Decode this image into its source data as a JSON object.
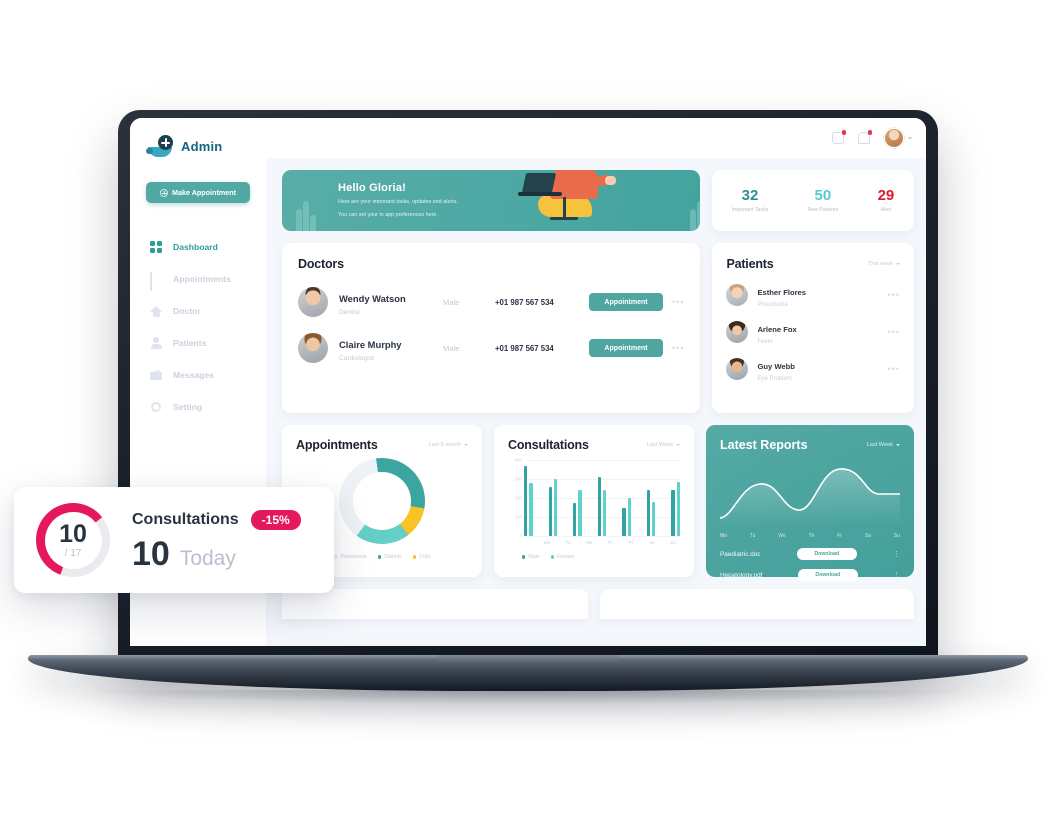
{
  "brand": {
    "name": "Admin",
    "icon": "medical-hand-icon"
  },
  "sidebar": {
    "cta": {
      "label": "Make Appointment",
      "icon": "plus-circle-icon"
    },
    "items": [
      {
        "label": "Dashboard",
        "icon": "grid-icon",
        "active": true
      },
      {
        "label": "Appointments",
        "icon": "calendar-icon",
        "active": false
      },
      {
        "label": "Doctor",
        "icon": "home-icon",
        "active": false
      },
      {
        "label": "Patients",
        "icon": "user-icon",
        "active": false
      },
      {
        "label": "Messages",
        "icon": "briefcase-icon",
        "active": false
      },
      {
        "label": "Setting",
        "icon": "gear-icon",
        "active": false
      }
    ]
  },
  "topbar": {
    "icons": [
      "message-icon",
      "bell-icon"
    ],
    "avatar": "user-avatar"
  },
  "hero": {
    "title": "Hello Gloria!",
    "line1": "Here are your important tasks, updates and alerts.",
    "line2": "You can set your in app preferences here."
  },
  "stats": [
    {
      "value": "32",
      "label": "Important Tasks",
      "color": "#2b8f95"
    },
    {
      "value": "50",
      "label": "New Patients",
      "color": "#57c8d3"
    },
    {
      "value": "29",
      "label": "Alert",
      "color": "#e01b2e"
    }
  ],
  "doctors": {
    "title": "Doctors",
    "rows": [
      {
        "name": "Wendy Watson",
        "role": "Dentist",
        "gender": "Male",
        "phone": "+01 987 567 534",
        "action": "Appointment"
      },
      {
        "name": "Claire Murphy",
        "role": "Cardiologist",
        "gender": "Male",
        "phone": "+01 987 567 534",
        "action": "Appointment"
      }
    ]
  },
  "patients": {
    "title": "Patients",
    "filter": "This week",
    "rows": [
      {
        "name": "Esther Flores",
        "condition": "Pneumonia"
      },
      {
        "name": "Arlene Fox",
        "condition": "Fever"
      },
      {
        "name": "Guy Webb",
        "condition": "Eye Problem"
      }
    ]
  },
  "appointments": {
    "title": "Appointments",
    "filter": "Last 6 month",
    "legend": [
      {
        "label": "Pneumonia",
        "color": "#eef1f5"
      },
      {
        "label": "Diabets",
        "color": "#3ba6a0"
      },
      {
        "label": "Cold",
        "color": "#f8c326"
      }
    ]
  },
  "consultations": {
    "title": "Consultations",
    "filter": "Last Week",
    "legend": [
      {
        "label": "Male",
        "color": "#34a2a3"
      },
      {
        "label": "Female",
        "color": "#5fd2cd"
      }
    ]
  },
  "reports": {
    "title": "Latest Reports",
    "filter": "Last Week",
    "days": [
      "Mo",
      "Tu",
      "We",
      "Th",
      "Fr",
      "Sa",
      "Su"
    ],
    "files": [
      {
        "name": "Paediatric.doc",
        "action": "Download"
      },
      {
        "name": "Hepatology.pdf",
        "action": "Download"
      }
    ]
  },
  "float_card": {
    "title": "Consultations",
    "badge": "-15%",
    "gauge_value": "10",
    "gauge_total": "/ 17",
    "big_value": "10",
    "period": "Today",
    "accent": "#e4175f"
  },
  "chart_data": [
    {
      "type": "bar",
      "title": "Consultations",
      "xlabel": "",
      "ylabel": "",
      "categories": [
        "Mo",
        "Tu",
        "We",
        "Th",
        "Fr",
        "Sa",
        "Su"
      ],
      "yticks": [
        0,
        100,
        200,
        300,
        400
      ],
      "ylim": [
        0,
        400
      ],
      "grid": true,
      "legend_position": "bottom-left",
      "series": [
        {
          "name": "Male",
          "color": "#34a2a3",
          "values": [
            370,
            260,
            175,
            310,
            150,
            240,
            240
          ]
        },
        {
          "name": "Female",
          "color": "#5fd2cd",
          "values": [
            280,
            300,
            240,
            240,
            200,
            180,
            285
          ]
        }
      ]
    },
    {
      "type": "pie",
      "title": "Appointments",
      "subtitle": "Last 6 month",
      "labels": [
        "Diabets",
        "Cold",
        "Pneumonia",
        "Remaining"
      ],
      "values": [
        28,
        12,
        20,
        40
      ],
      "colors": [
        "#3ba6a0",
        "#f8c326",
        "#63cfc6",
        "#eef1f5"
      ],
      "legend_position": "bottom"
    },
    {
      "type": "line",
      "title": "Latest Reports",
      "subtitle": "Last Week",
      "x": [
        "Mo",
        "Tu",
        "We",
        "Th",
        "Fr",
        "Sa",
        "Su"
      ],
      "series": [
        {
          "name": "Reports",
          "color": "#ffffff",
          "values": [
            10,
            52,
            58,
            28,
            40,
            86,
            62
          ]
        }
      ],
      "grid": false,
      "legend_position": "none"
    },
    {
      "type": "pie",
      "title": "Consultations today",
      "labels": [
        "Completed",
        "Remaining"
      ],
      "values": [
        10,
        7
      ],
      "colors": [
        "#e4175f",
        "#ece9ef"
      ],
      "annotation": "10 / 17",
      "legend_position": "none"
    }
  ]
}
